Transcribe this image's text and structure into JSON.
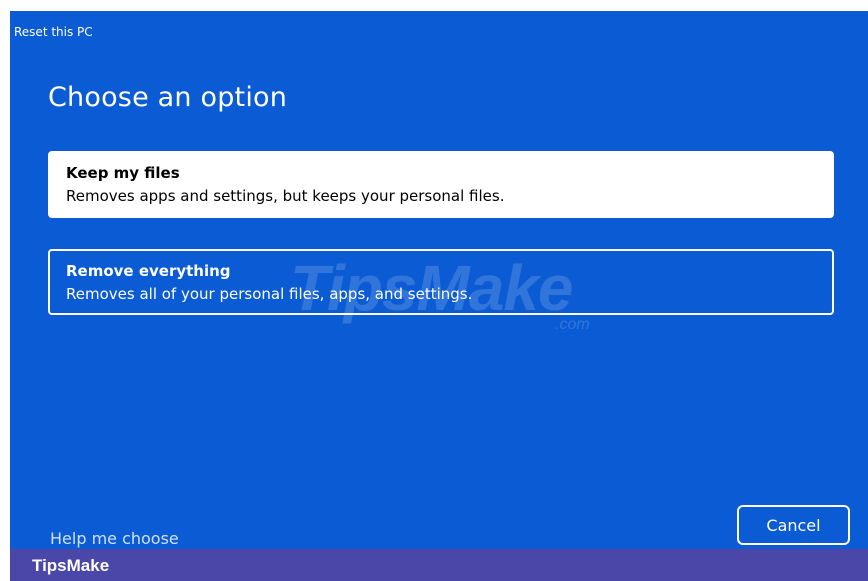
{
  "window": {
    "title": "Reset this PC"
  },
  "heading": "Choose an option",
  "options": [
    {
      "title": "Keep my files",
      "description": "Removes apps and settings, but keeps your personal files."
    },
    {
      "title": "Remove everything",
      "description": "Removes all of your personal files, apps, and settings."
    }
  ],
  "footer": {
    "help_link": "Help me choose",
    "cancel_label": "Cancel"
  },
  "watermark": {
    "text": "TipsMake",
    "suffix": ".com"
  },
  "brand_bar": {
    "label": "TipsMake"
  },
  "colors": {
    "dialog_background": "#0a5bd4",
    "selected_option_background": "#ffffff",
    "brand_bar_background": "#4b47a8"
  }
}
